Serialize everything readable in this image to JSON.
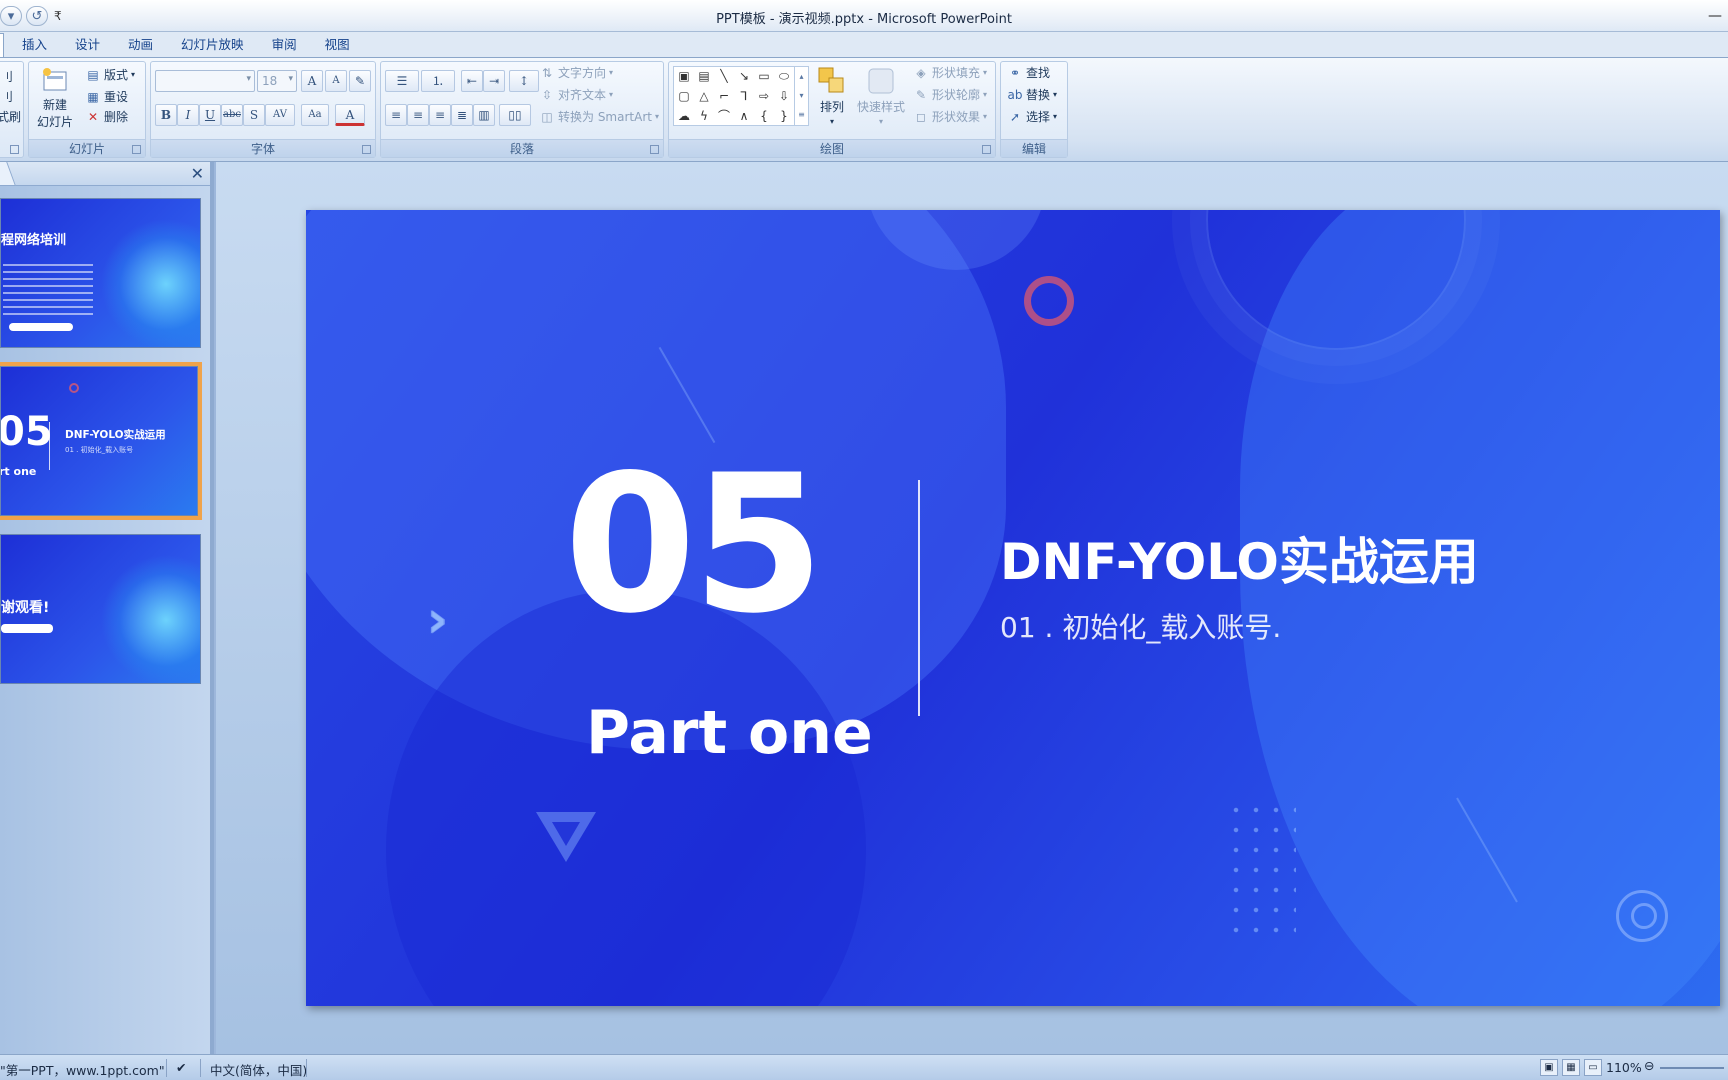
{
  "window": {
    "title": "PPT模板 - 演示视频.pptx - Microsoft PowerPoint"
  },
  "ribbon_tabs": [
    "插入",
    "设计",
    "动画",
    "幻灯片放映",
    "审阅",
    "视图"
  ],
  "ribbon": {
    "slides_group": {
      "label": "幻灯片",
      "new_slide_line1": "新建",
      "new_slide_line2": "幻灯片",
      "layout": "版式",
      "reset": "重设",
      "delete": "删除"
    },
    "font_group": {
      "label": "字体",
      "font_size": "18"
    },
    "paragraph_group": {
      "label": "段落",
      "text_direction": "文字方向",
      "align_text": "对齐文本",
      "convert_smartart": "转换为 SmartArt"
    },
    "drawing_group": {
      "label": "绘图",
      "arrange": "排列",
      "quick_styles": "快速样式",
      "shape_fill": "形状填充",
      "shape_outline": "形状轮廓",
      "shape_effects": "形状效果"
    },
    "editing_group": {
      "label": "编辑",
      "find": "查找",
      "replace": "替换",
      "select": "选择"
    },
    "partial_left_labels": [
      "刂",
      "刂",
      "式刷"
    ]
  },
  "slide_panel": {
    "thumbnails": [
      {
        "title": "程网络培训",
        "selected": false
      },
      {
        "number": "05",
        "part": "rt one",
        "title": "DNF-YOLO实战运用",
        "subtitle": "01 . 初始化_载入账号",
        "selected": true
      },
      {
        "title": "谢观看!",
        "selected": false
      }
    ]
  },
  "slide": {
    "number": "05",
    "part_label": "Part one",
    "title": "DNF-YOLO实战运用",
    "subtitle": "01 . 初始化_载入账号."
  },
  "statusbar": {
    "theme": "\"第一PPT，www.1ppt.com\"",
    "language": "中文(简体，中国)",
    "zoom": "110%"
  }
}
